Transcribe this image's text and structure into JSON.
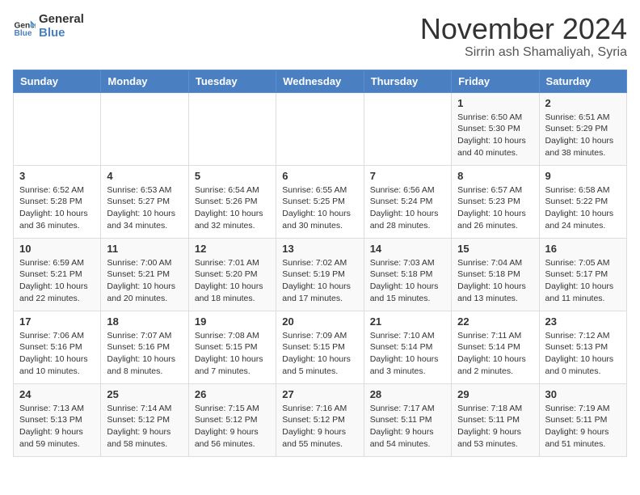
{
  "header": {
    "logo_line1": "General",
    "logo_line2": "Blue",
    "month": "November 2024",
    "location": "Sirrin ash Shamaliyah, Syria"
  },
  "days_of_week": [
    "Sunday",
    "Monday",
    "Tuesday",
    "Wednesday",
    "Thursday",
    "Friday",
    "Saturday"
  ],
  "weeks": [
    [
      {
        "day": "",
        "info": ""
      },
      {
        "day": "",
        "info": ""
      },
      {
        "day": "",
        "info": ""
      },
      {
        "day": "",
        "info": ""
      },
      {
        "day": "",
        "info": ""
      },
      {
        "day": "1",
        "info": "Sunrise: 6:50 AM\nSunset: 5:30 PM\nDaylight: 10 hours\nand 40 minutes."
      },
      {
        "day": "2",
        "info": "Sunrise: 6:51 AM\nSunset: 5:29 PM\nDaylight: 10 hours\nand 38 minutes."
      }
    ],
    [
      {
        "day": "3",
        "info": "Sunrise: 6:52 AM\nSunset: 5:28 PM\nDaylight: 10 hours\nand 36 minutes."
      },
      {
        "day": "4",
        "info": "Sunrise: 6:53 AM\nSunset: 5:27 PM\nDaylight: 10 hours\nand 34 minutes."
      },
      {
        "day": "5",
        "info": "Sunrise: 6:54 AM\nSunset: 5:26 PM\nDaylight: 10 hours\nand 32 minutes."
      },
      {
        "day": "6",
        "info": "Sunrise: 6:55 AM\nSunset: 5:25 PM\nDaylight: 10 hours\nand 30 minutes."
      },
      {
        "day": "7",
        "info": "Sunrise: 6:56 AM\nSunset: 5:24 PM\nDaylight: 10 hours\nand 28 minutes."
      },
      {
        "day": "8",
        "info": "Sunrise: 6:57 AM\nSunset: 5:23 PM\nDaylight: 10 hours\nand 26 minutes."
      },
      {
        "day": "9",
        "info": "Sunrise: 6:58 AM\nSunset: 5:22 PM\nDaylight: 10 hours\nand 24 minutes."
      }
    ],
    [
      {
        "day": "10",
        "info": "Sunrise: 6:59 AM\nSunset: 5:21 PM\nDaylight: 10 hours\nand 22 minutes."
      },
      {
        "day": "11",
        "info": "Sunrise: 7:00 AM\nSunset: 5:21 PM\nDaylight: 10 hours\nand 20 minutes."
      },
      {
        "day": "12",
        "info": "Sunrise: 7:01 AM\nSunset: 5:20 PM\nDaylight: 10 hours\nand 18 minutes."
      },
      {
        "day": "13",
        "info": "Sunrise: 7:02 AM\nSunset: 5:19 PM\nDaylight: 10 hours\nand 17 minutes."
      },
      {
        "day": "14",
        "info": "Sunrise: 7:03 AM\nSunset: 5:18 PM\nDaylight: 10 hours\nand 15 minutes."
      },
      {
        "day": "15",
        "info": "Sunrise: 7:04 AM\nSunset: 5:18 PM\nDaylight: 10 hours\nand 13 minutes."
      },
      {
        "day": "16",
        "info": "Sunrise: 7:05 AM\nSunset: 5:17 PM\nDaylight: 10 hours\nand 11 minutes."
      }
    ],
    [
      {
        "day": "17",
        "info": "Sunrise: 7:06 AM\nSunset: 5:16 PM\nDaylight: 10 hours\nand 10 minutes."
      },
      {
        "day": "18",
        "info": "Sunrise: 7:07 AM\nSunset: 5:16 PM\nDaylight: 10 hours\nand 8 minutes."
      },
      {
        "day": "19",
        "info": "Sunrise: 7:08 AM\nSunset: 5:15 PM\nDaylight: 10 hours\nand 7 minutes."
      },
      {
        "day": "20",
        "info": "Sunrise: 7:09 AM\nSunset: 5:15 PM\nDaylight: 10 hours\nand 5 minutes."
      },
      {
        "day": "21",
        "info": "Sunrise: 7:10 AM\nSunset: 5:14 PM\nDaylight: 10 hours\nand 3 minutes."
      },
      {
        "day": "22",
        "info": "Sunrise: 7:11 AM\nSunset: 5:14 PM\nDaylight: 10 hours\nand 2 minutes."
      },
      {
        "day": "23",
        "info": "Sunrise: 7:12 AM\nSunset: 5:13 PM\nDaylight: 10 hours\nand 0 minutes."
      }
    ],
    [
      {
        "day": "24",
        "info": "Sunrise: 7:13 AM\nSunset: 5:13 PM\nDaylight: 9 hours\nand 59 minutes."
      },
      {
        "day": "25",
        "info": "Sunrise: 7:14 AM\nSunset: 5:12 PM\nDaylight: 9 hours\nand 58 minutes."
      },
      {
        "day": "26",
        "info": "Sunrise: 7:15 AM\nSunset: 5:12 PM\nDaylight: 9 hours\nand 56 minutes."
      },
      {
        "day": "27",
        "info": "Sunrise: 7:16 AM\nSunset: 5:12 PM\nDaylight: 9 hours\nand 55 minutes."
      },
      {
        "day": "28",
        "info": "Sunrise: 7:17 AM\nSunset: 5:11 PM\nDaylight: 9 hours\nand 54 minutes."
      },
      {
        "day": "29",
        "info": "Sunrise: 7:18 AM\nSunset: 5:11 PM\nDaylight: 9 hours\nand 53 minutes."
      },
      {
        "day": "30",
        "info": "Sunrise: 7:19 AM\nSunset: 5:11 PM\nDaylight: 9 hours\nand 51 minutes."
      }
    ]
  ]
}
